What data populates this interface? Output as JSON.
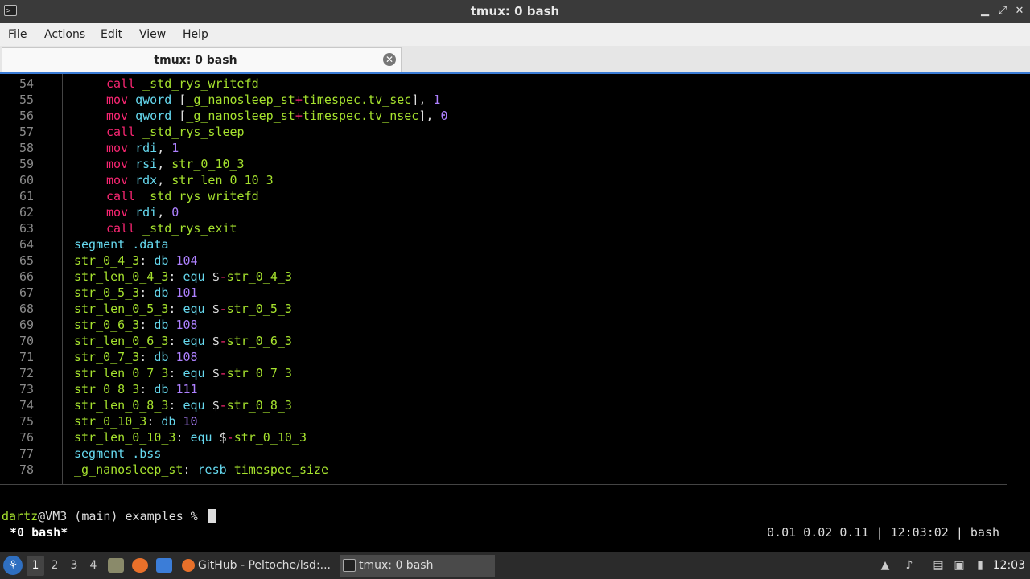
{
  "window": {
    "title": "tmux: 0 bash",
    "icon": "terminal-icon",
    "controls": {
      "minimize": "▁",
      "maximize": "⤢",
      "close": "✕"
    }
  },
  "menubar": {
    "items": [
      "File",
      "Actions",
      "Edit",
      "View",
      "Help"
    ]
  },
  "tab": {
    "label": "tmux: 0 bash",
    "close": "✕"
  },
  "colors": {
    "keyword": "#f92672",
    "symbol": "#a6e22e",
    "directive": "#66d9ef",
    "number": "#ae81ff",
    "border": "#3a7bd5"
  },
  "code": [
    {
      "n": "54",
      "indent": 2,
      "tokens": [
        [
          "kw",
          "call"
        ],
        [
          "plain",
          " "
        ],
        [
          "sym",
          "_std_rys_writefd"
        ]
      ]
    },
    {
      "n": "55",
      "indent": 2,
      "tokens": [
        [
          "kw",
          "mov"
        ],
        [
          "plain",
          " "
        ],
        [
          "dir",
          "qword"
        ],
        [
          "plain",
          " ["
        ],
        [
          "sym",
          "_g_nanosleep_st"
        ],
        [
          "op",
          "+"
        ],
        [
          "sym",
          "timespec.tv_sec"
        ],
        [
          "plain",
          "], "
        ],
        [
          "num",
          "1"
        ]
      ]
    },
    {
      "n": "56",
      "indent": 2,
      "tokens": [
        [
          "kw",
          "mov"
        ],
        [
          "plain",
          " "
        ],
        [
          "dir",
          "qword"
        ],
        [
          "plain",
          " ["
        ],
        [
          "sym",
          "_g_nanosleep_st"
        ],
        [
          "op",
          "+"
        ],
        [
          "sym",
          "timespec.tv_nsec"
        ],
        [
          "plain",
          "], "
        ],
        [
          "num",
          "0"
        ]
      ]
    },
    {
      "n": "57",
      "indent": 2,
      "tokens": [
        [
          "kw",
          "call"
        ],
        [
          "plain",
          " "
        ],
        [
          "sym",
          "_std_rys_sleep"
        ]
      ]
    },
    {
      "n": "58",
      "indent": 2,
      "tokens": [
        [
          "kw",
          "mov"
        ],
        [
          "plain",
          " "
        ],
        [
          "dir",
          "rdi"
        ],
        [
          "plain",
          ", "
        ],
        [
          "num",
          "1"
        ]
      ]
    },
    {
      "n": "59",
      "indent": 2,
      "tokens": [
        [
          "kw",
          "mov"
        ],
        [
          "plain",
          " "
        ],
        [
          "dir",
          "rsi"
        ],
        [
          "plain",
          ", "
        ],
        [
          "sym",
          "str_0_10_3"
        ]
      ]
    },
    {
      "n": "60",
      "indent": 2,
      "tokens": [
        [
          "kw",
          "mov"
        ],
        [
          "plain",
          " "
        ],
        [
          "dir",
          "rdx"
        ],
        [
          "plain",
          ", "
        ],
        [
          "sym",
          "str_len_0_10_3"
        ]
      ]
    },
    {
      "n": "61",
      "indent": 2,
      "tokens": [
        [
          "kw",
          "call"
        ],
        [
          "plain",
          " "
        ],
        [
          "sym",
          "_std_rys_writefd"
        ]
      ]
    },
    {
      "n": "62",
      "indent": 2,
      "tokens": [
        [
          "kw",
          "mov"
        ],
        [
          "plain",
          " "
        ],
        [
          "dir",
          "rdi"
        ],
        [
          "plain",
          ", "
        ],
        [
          "num",
          "0"
        ]
      ]
    },
    {
      "n": "63",
      "indent": 2,
      "tokens": [
        [
          "kw",
          "call"
        ],
        [
          "plain",
          " "
        ],
        [
          "sym",
          "_std_rys_exit"
        ]
      ]
    },
    {
      "n": "64",
      "indent": 1,
      "tokens": [
        [
          "dir",
          "segment"
        ],
        [
          "plain",
          " "
        ],
        [
          "dir",
          ".data"
        ]
      ]
    },
    {
      "n": "65",
      "indent": 1,
      "tokens": [
        [
          "sym",
          "str_0_4_3"
        ],
        [
          "plain",
          ": "
        ],
        [
          "dir",
          "db"
        ],
        [
          "plain",
          " "
        ],
        [
          "num",
          "104"
        ]
      ]
    },
    {
      "n": "66",
      "indent": 1,
      "tokens": [
        [
          "sym",
          "str_len_0_4_3"
        ],
        [
          "plain",
          ": "
        ],
        [
          "dir",
          "equ"
        ],
        [
          "plain",
          " $"
        ],
        [
          "op",
          "-"
        ],
        [
          "sym",
          "str_0_4_3"
        ]
      ]
    },
    {
      "n": "67",
      "indent": 1,
      "tokens": [
        [
          "sym",
          "str_0_5_3"
        ],
        [
          "plain",
          ": "
        ],
        [
          "dir",
          "db"
        ],
        [
          "plain",
          " "
        ],
        [
          "num",
          "101"
        ]
      ]
    },
    {
      "n": "68",
      "indent": 1,
      "tokens": [
        [
          "sym",
          "str_len_0_5_3"
        ],
        [
          "plain",
          ": "
        ],
        [
          "dir",
          "equ"
        ],
        [
          "plain",
          " $"
        ],
        [
          "op",
          "-"
        ],
        [
          "sym",
          "str_0_5_3"
        ]
      ]
    },
    {
      "n": "69",
      "indent": 1,
      "tokens": [
        [
          "sym",
          "str_0_6_3"
        ],
        [
          "plain",
          ": "
        ],
        [
          "dir",
          "db"
        ],
        [
          "plain",
          " "
        ],
        [
          "num",
          "108"
        ]
      ]
    },
    {
      "n": "70",
      "indent": 1,
      "tokens": [
        [
          "sym",
          "str_len_0_6_3"
        ],
        [
          "plain",
          ": "
        ],
        [
          "dir",
          "equ"
        ],
        [
          "plain",
          " $"
        ],
        [
          "op",
          "-"
        ],
        [
          "sym",
          "str_0_6_3"
        ]
      ]
    },
    {
      "n": "71",
      "indent": 1,
      "tokens": [
        [
          "sym",
          "str_0_7_3"
        ],
        [
          "plain",
          ": "
        ],
        [
          "dir",
          "db"
        ],
        [
          "plain",
          " "
        ],
        [
          "num",
          "108"
        ]
      ]
    },
    {
      "n": "72",
      "indent": 1,
      "tokens": [
        [
          "sym",
          "str_len_0_7_3"
        ],
        [
          "plain",
          ": "
        ],
        [
          "dir",
          "equ"
        ],
        [
          "plain",
          " $"
        ],
        [
          "op",
          "-"
        ],
        [
          "sym",
          "str_0_7_3"
        ]
      ]
    },
    {
      "n": "73",
      "indent": 1,
      "tokens": [
        [
          "sym",
          "str_0_8_3"
        ],
        [
          "plain",
          ": "
        ],
        [
          "dir",
          "db"
        ],
        [
          "plain",
          " "
        ],
        [
          "num",
          "111"
        ]
      ]
    },
    {
      "n": "74",
      "indent": 1,
      "tokens": [
        [
          "sym",
          "str_len_0_8_3"
        ],
        [
          "plain",
          ": "
        ],
        [
          "dir",
          "equ"
        ],
        [
          "plain",
          " $"
        ],
        [
          "op",
          "-"
        ],
        [
          "sym",
          "str_0_8_3"
        ]
      ]
    },
    {
      "n": "75",
      "indent": 1,
      "tokens": [
        [
          "sym",
          "str_0_10_3"
        ],
        [
          "plain",
          ": "
        ],
        [
          "dir",
          "db"
        ],
        [
          "plain",
          " "
        ],
        [
          "num",
          "10"
        ]
      ]
    },
    {
      "n": "76",
      "indent": 1,
      "tokens": [
        [
          "sym",
          "str_len_0_10_3"
        ],
        [
          "plain",
          ": "
        ],
        [
          "dir",
          "equ"
        ],
        [
          "plain",
          " $"
        ],
        [
          "op",
          "-"
        ],
        [
          "sym",
          "str_0_10_3"
        ]
      ]
    },
    {
      "n": "77",
      "indent": 1,
      "tokens": [
        [
          "dir",
          "segment"
        ],
        [
          "plain",
          " "
        ],
        [
          "dir",
          ".bss"
        ]
      ]
    },
    {
      "n": "78",
      "indent": 1,
      "tokens": [
        [
          "sym",
          "_g_nanosleep_st"
        ],
        [
          "plain",
          ": "
        ],
        [
          "dir",
          "resb"
        ],
        [
          "plain",
          " "
        ],
        [
          "sym",
          "timespec_size"
        ]
      ]
    }
  ],
  "prompt": {
    "user": "dartz",
    "rest": "@VM3 (main) examples % "
  },
  "tmux_status": {
    "left": "*0 bash*",
    "right": "0.01 0.02 0.11 | 12:03:02 | bash"
  },
  "taskbar": {
    "menu_icon": "start-menu-icon",
    "workspaces": [
      "1",
      "2",
      "3",
      "4"
    ],
    "active_workspace": "1",
    "quicklaunch": [
      "file-manager-icon",
      "firefox-icon",
      "desktop-icon"
    ],
    "tasks": [
      {
        "label": "GitHub - Peltoche/lsd:...",
        "icon": "firefox-icon",
        "active": false
      },
      {
        "label": "tmux: 0 bash",
        "icon": "terminal-icon",
        "active": true
      }
    ],
    "tray": [
      "network-icon",
      "volume-icon",
      "clipboard-icon",
      "display-icon",
      "battery-icon"
    ],
    "clock": "12:03"
  }
}
